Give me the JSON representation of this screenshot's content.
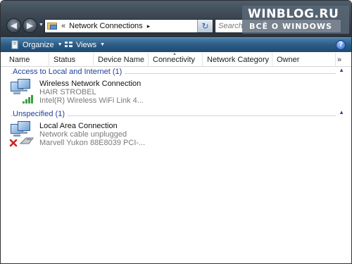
{
  "window": {
    "address": {
      "chevrons": "«",
      "text": "Network Connections",
      "arrow": "▸"
    },
    "search_placeholder": "Search",
    "watermark": {
      "line1": "WINBLOG.RU",
      "line2": "ВСЁ О WINDOWS"
    }
  },
  "toolbar": {
    "organize_label": "Organize",
    "views_label": "Views",
    "caret": "▼",
    "help_label": "?"
  },
  "columns": {
    "name": "Name",
    "status": "Status",
    "device_name": "Device Name",
    "connectivity": "Connectivity",
    "network_category": "Network Category",
    "owner": "Owner",
    "more": "»"
  },
  "groups": [
    {
      "title": "Access to Local and Internet (1)",
      "items": [
        {
          "name": "Wireless Network Connection",
          "status": "HAIR STROBEL",
          "device": "Intel(R) Wireless WiFi Link 4..."
        }
      ]
    },
    {
      "title": "Unspecified (1)",
      "items": [
        {
          "name": "Local Area Connection",
          "status": "Network cable unplugged",
          "device": "Marvell Yukon 88E8039 PCI-..."
        }
      ]
    }
  ],
  "icons": {
    "back": "back-arrow-icon",
    "forward": "forward-arrow-icon",
    "refresh": "refresh-icon",
    "help": "help-icon",
    "collapse": "collapse-chevron-icon"
  },
  "colors": {
    "toolbar": "#2b5b85",
    "group_header_text": "#1e3f9a",
    "signal_bars": "#3aa043",
    "error_x": "#d21f1f"
  }
}
